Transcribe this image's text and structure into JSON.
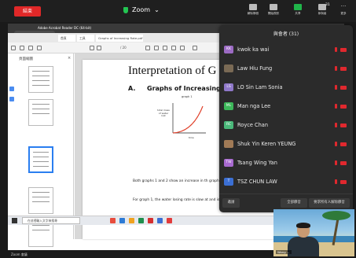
{
  "zoom": {
    "leave_label": "結束",
    "title": "Zoom",
    "toolbar": [
      {
        "label": "解除靜音",
        "green": false
      },
      {
        "label": "開始視訊",
        "green": false
      },
      {
        "label": "共享",
        "green": true
      },
      {
        "label": "參與者",
        "green": false,
        "count": "31"
      },
      {
        "label": "更多",
        "green": false
      }
    ]
  },
  "share": {
    "pill_label": "停止共享",
    "window_title": "Adobe Acrobat Reader DC (64-bit)",
    "tabs": [
      "首頁",
      "工具",
      "Graphs of Increasing Rate.pdf"
    ],
    "page_indicator": "/ 20",
    "thumbs_header": "頁面縮圖"
  },
  "doc": {
    "heading": "Interpretation of G",
    "sub_letter": "A.",
    "sub_title": "Graphs of Increasing R",
    "graph_title": "graph 1",
    "graph_ylabel": "total mass of water lost",
    "graph_xlabel": "time",
    "paragraphs": [
      "Both graphs 1 and 2 show an increase in th graphs are > 0.",
      "For graph 1, the water losing rate is slow at and is the highest at the end.",
      "For graph 2, the water losing rate is high at stage and nearly stops at the end (slope ="
    ]
  },
  "participants": {
    "title": "與會者 (31)",
    "list": [
      {
        "initials": "KK",
        "name": "kwok ka wai",
        "color": "#9c6bc4"
      },
      {
        "initials": "",
        "name": "Law Hiu Fung",
        "color": "#7a6a55"
      },
      {
        "initials": "LS",
        "name": "LO Sin Lam Sonia",
        "color": "#8f78c9"
      },
      {
        "initials": "ML",
        "name": "Man nga Lee",
        "color": "#3db85a"
      },
      {
        "initials": "RC",
        "name": "Royce Chan",
        "color": "#4ab87a"
      },
      {
        "initials": "",
        "name": "Shuk Yin Keren YEUNG",
        "color": "#a07a56"
      },
      {
        "initials": "TW",
        "name": "Tsang Wing Yan",
        "color": "#a86ad0"
      },
      {
        "initials": "T",
        "name": "TSZ CHUN LAW",
        "color": "#3b6fd4"
      }
    ],
    "footer": {
      "invite": "邀請",
      "mute_all": "全部靜音",
      "more": "要求所有人解除靜音"
    }
  },
  "taskbar": {
    "search_placeholder": "在這裡輸入文字來搜尋"
  },
  "self_video": {
    "name": "Wong ...",
    "colors": {
      "sea": "#3b86b9"
    }
  },
  "bottom_label": "Zoom 會議"
}
